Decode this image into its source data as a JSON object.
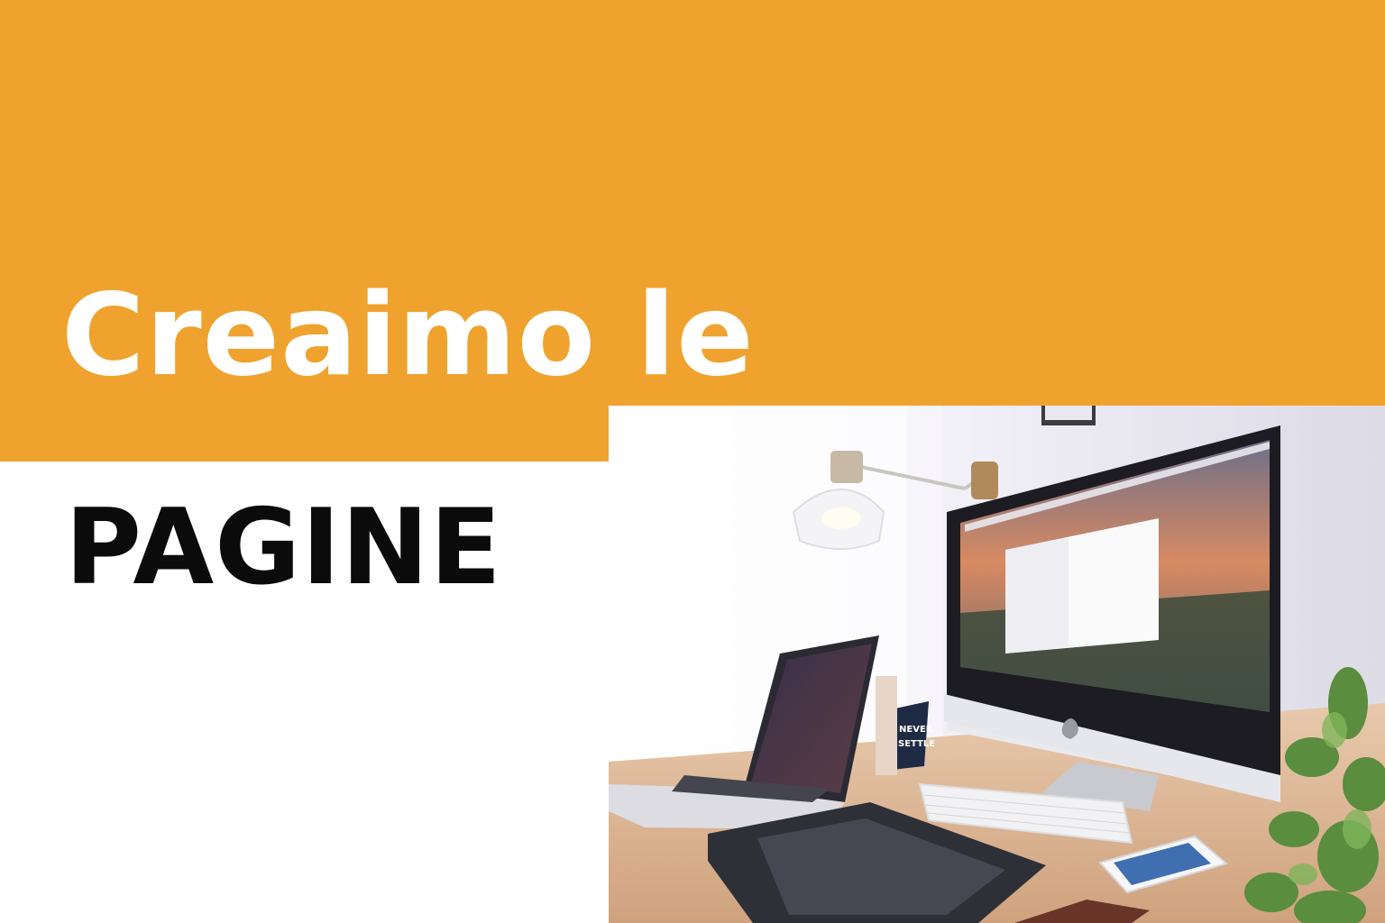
{
  "headline": {
    "line1": "Creaimo le",
    "line2": "PAGINE"
  },
  "colors": {
    "band": "#f0a22e",
    "line1": "#ffffff",
    "line2": "#0b0b0b",
    "background": "#ffffff"
  },
  "photo": {
    "poster_text": [
      "NEVER",
      "SETTLE"
    ]
  }
}
